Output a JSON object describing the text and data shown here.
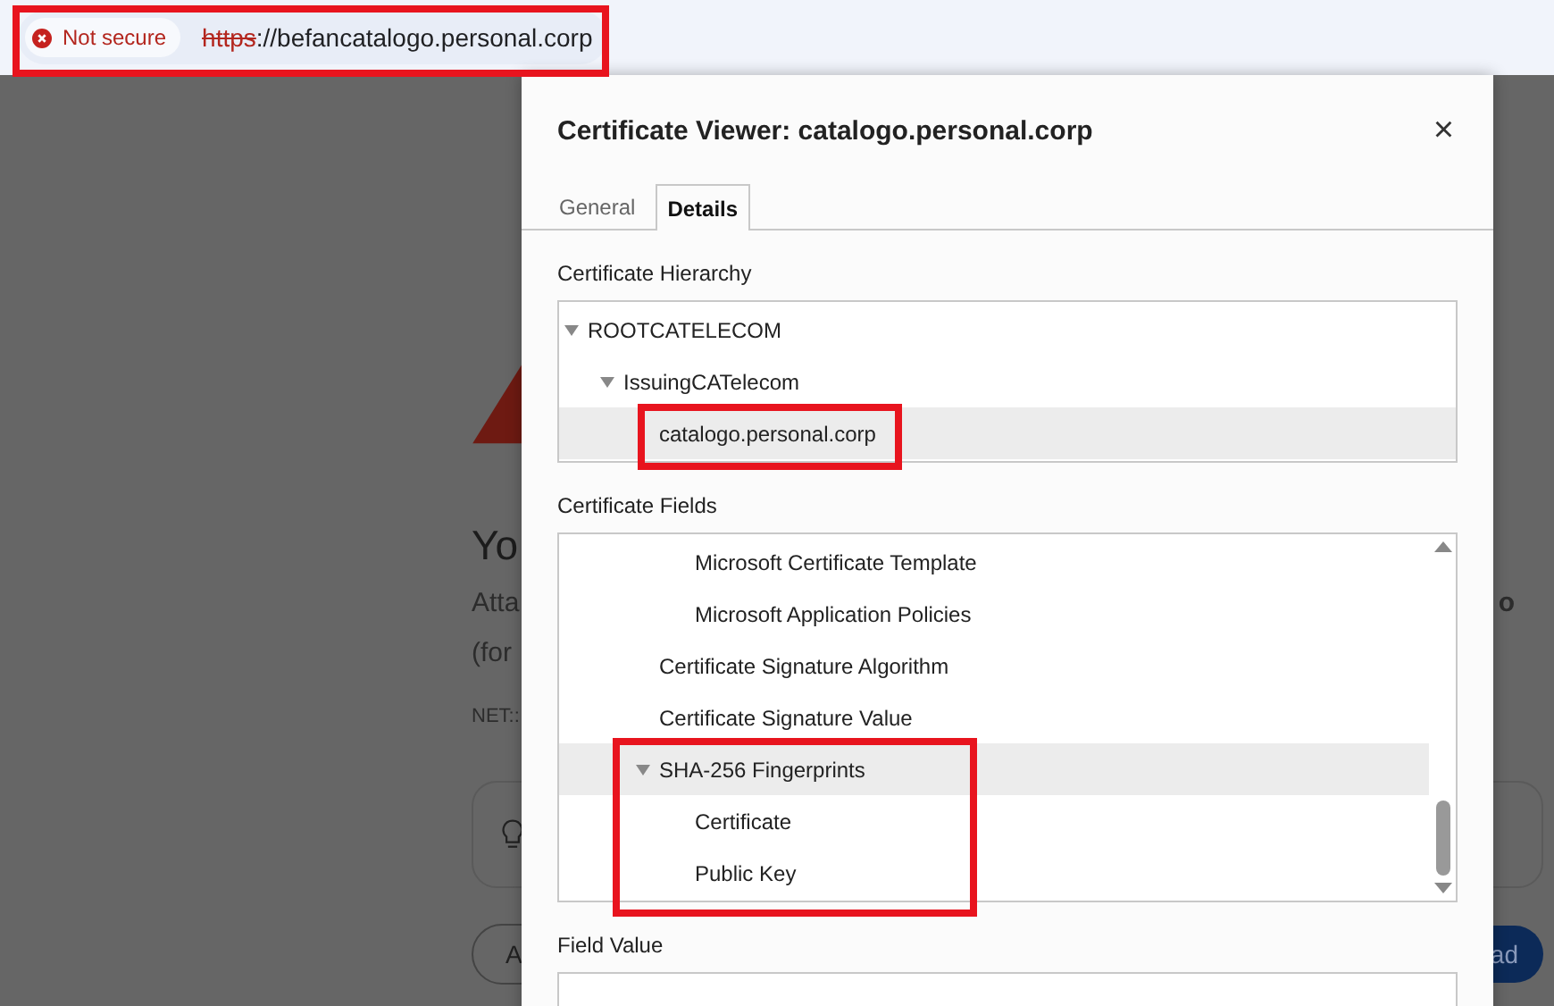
{
  "address_bar": {
    "security_label": "Not secure",
    "url_scheme": "https",
    "url_rest": "://befancatalogo.personal.corp"
  },
  "background_page": {
    "heading": "Yo",
    "line_1_start": "Atta",
    "line_1_end": "o",
    "line_2_start": "(for",
    "error_code": "NET::",
    "left_button": "A",
    "right_button": "ad"
  },
  "dialog": {
    "title": "Certificate Viewer: catalogo.personal.corp",
    "close": "×",
    "tabs": [
      {
        "label": "General",
        "selected": false
      },
      {
        "label": "Details",
        "selected": true
      }
    ],
    "hierarchy_label": "Certificate Hierarchy",
    "hierarchy": [
      {
        "label": "ROOTCATELECOM",
        "expanded": true,
        "selected": false,
        "children": [
          {
            "label": "IssuingCATelecom",
            "expanded": true,
            "selected": false,
            "children": [
              {
                "label": "catalogo.personal.corp",
                "selected": true
              }
            ]
          }
        ]
      }
    ],
    "fields_label": "Certificate Fields",
    "fields": [
      {
        "children": [
          {
            "children": [
              {
                "children": [
                  {
                    "label": "Microsoft Certificate Template",
                    "selected": false
                  },
                  {
                    "label": "Microsoft Application Policies",
                    "selected": false
                  }
                ]
              },
              {
                "label": "Certificate Signature Algorithm",
                "selected": false
              },
              {
                "label": "Certificate Signature Value",
                "selected": false
              },
              {
                "label": "SHA-256 Fingerprints",
                "expanded": true,
                "selected": true,
                "children": [
                  {
                    "label": "Certificate",
                    "selected": false
                  },
                  {
                    "label": "Public Key",
                    "selected": false
                  }
                ]
              }
            ]
          }
        ]
      }
    ],
    "field_value_label": "Field Value"
  }
}
